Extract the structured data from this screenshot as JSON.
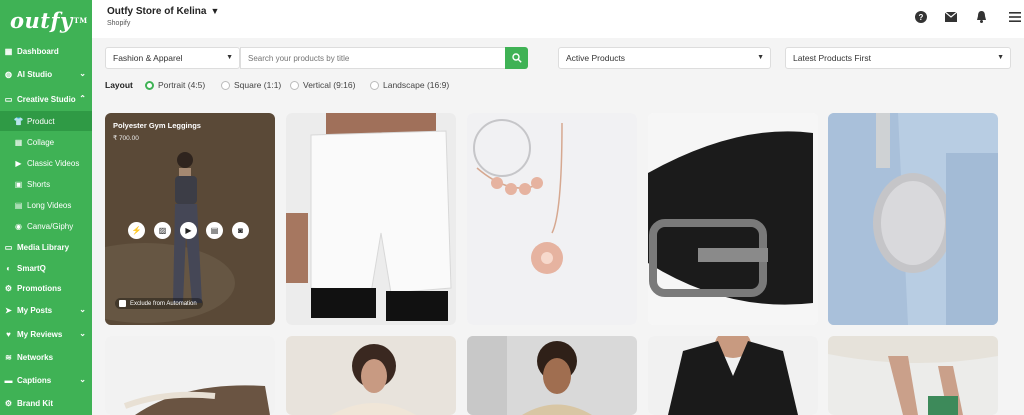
{
  "brand": {
    "logo_text": "outfy",
    "logo_mark": "TM"
  },
  "sidebar": {
    "items": [
      {
        "label": "Dashboard"
      },
      {
        "label": "AI Studio"
      },
      {
        "label": "Creative Studio"
      },
      {
        "label": "Product"
      },
      {
        "label": "Collage"
      },
      {
        "label": "Classic Videos"
      },
      {
        "label": "Shorts"
      },
      {
        "label": "Long Videos"
      },
      {
        "label": "Canva/Giphy"
      },
      {
        "label": "Media Library"
      },
      {
        "label": "SmartQ"
      },
      {
        "label": "Promotions"
      },
      {
        "label": "My Posts"
      },
      {
        "label": "My Reviews"
      },
      {
        "label": "Networks"
      },
      {
        "label": "Captions"
      },
      {
        "label": "Brand Kit"
      }
    ]
  },
  "header": {
    "store_name": "Outfy Store of Kelina",
    "platform": "Shopify"
  },
  "filters": {
    "category": "Fashion & Apparel",
    "search_placeholder": "Search your products by title",
    "status": "Active Products",
    "sort": "Latest Products First"
  },
  "layout": {
    "label": "Layout",
    "options": [
      "Portrait (4:5)",
      "Square (1:1)",
      "Vertical (9:16)",
      "Landscape (16:9)"
    ],
    "selected": "Portrait (4:5)"
  },
  "first_product": {
    "title": "Polyester Gym Leggings",
    "price": "₹ 700.00",
    "exclude_label": "Exclude from Automation"
  },
  "colors": {
    "accent": "#3fb255",
    "accent_dark": "#2f9a45"
  }
}
